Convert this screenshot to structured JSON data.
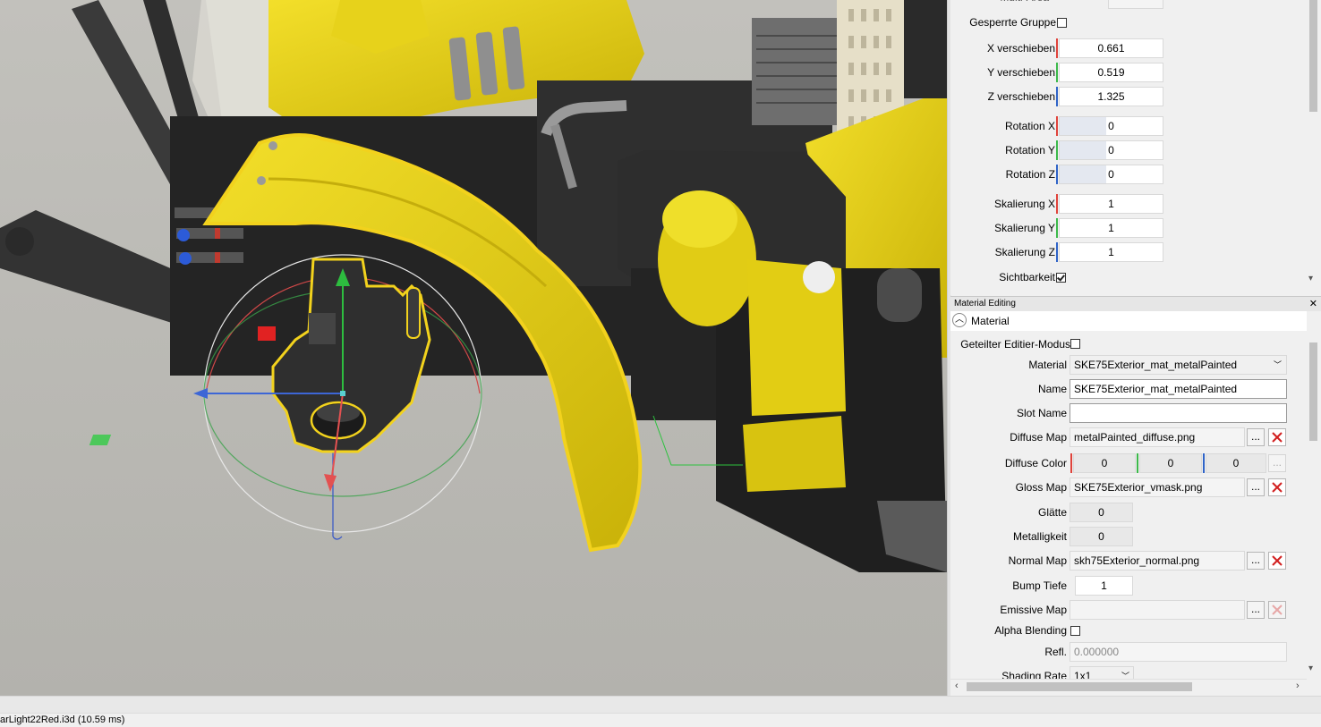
{
  "props": {
    "top_label": "Multi-Area",
    "gesperrte_gruppe": "Gesperrte Gruppe",
    "x_verschieben": "X verschieben",
    "x_value": "0.661",
    "y_verschieben": "Y verschieben",
    "y_value": "0.519",
    "z_verschieben": "Z verschieben",
    "z_value": "1.325",
    "rot_x": "Rotation X",
    "rot_x_value": "0",
    "rot_y": "Rotation Y",
    "rot_y_value": "0",
    "rot_z": "Rotation Z",
    "rot_z_value": "0",
    "scale_x": "Skalierung X",
    "scale_x_value": "1",
    "scale_y": "Skalierung Y",
    "scale_y_value": "1",
    "scale_z": "Skalierung Z",
    "scale_z_value": "1",
    "sichtbarkeit": "Sichtbarkeit"
  },
  "material_panel": {
    "title": "Material Editing",
    "close": "✕",
    "section": "Material",
    "geteilter_label": "Geteilter Editier-Modus",
    "material_label": "Material",
    "material_value": "SKE75Exterior_mat_metalPainted",
    "name_label": "Name",
    "name_value": "SKE75Exterior_mat_metalPainted",
    "slot_label": "Slot Name",
    "slot_value": "",
    "diffuse_map_label": "Diffuse Map",
    "diffuse_map_value": "metalPainted_diffuse.png",
    "diffuse_color_label": "Diffuse Color",
    "diffuse_r": "0",
    "diffuse_g": "0",
    "diffuse_b": "0",
    "gloss_map_label": "Gloss Map",
    "gloss_map_value": "SKE75Exterior_vmask.png",
    "glaette_label": "Glätte",
    "glaette_value": "0",
    "metallig_label": "Metalligkeit",
    "metallig_value": "0",
    "normal_map_label": "Normal Map",
    "normal_map_value": "skh75Exterior_normal.png",
    "bump_label": "Bump Tiefe",
    "bump_value": "1",
    "emissive_label": "Emissive Map",
    "emissive_value": "",
    "alpha_label": "Alpha Blending",
    "refl_label": "Refl.",
    "refl_value": "0.000000",
    "shading_label": "Shading Rate",
    "shading_value": "1x1",
    "browse": "..."
  },
  "status": {
    "text": "arLight22Red.i3d (10.59 ms)"
  },
  "colors": {
    "axis_x": "#e0433b",
    "axis_y": "#3cb94a",
    "axis_z": "#2f64c8",
    "selection": "#f2d21d",
    "delete_red": "#d22020"
  }
}
